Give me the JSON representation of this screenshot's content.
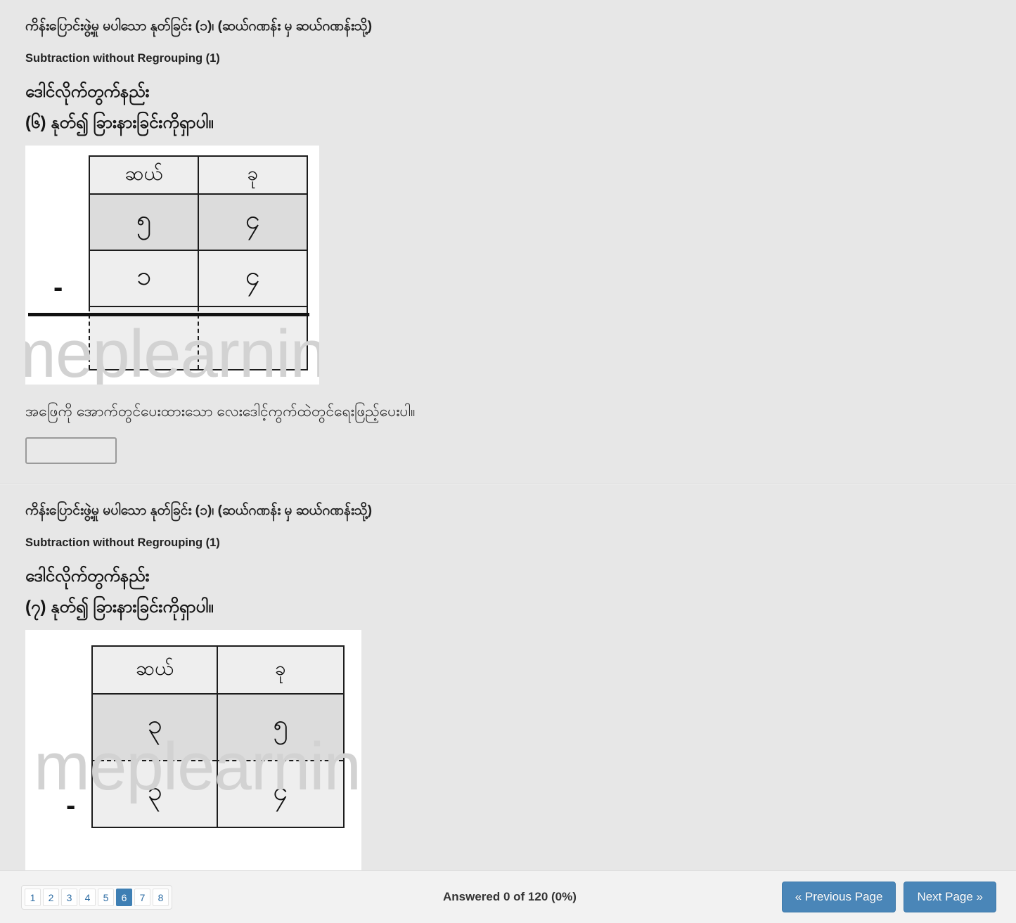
{
  "questions": [
    {
      "title_my": "ကိန်းပြောင်းဖွဲ့မှု မပါသော နုတ်ခြင်း (၁)၊ (ဆယ်ဂဏန်း မှ ဆယ်ဂဏန်းသို့)",
      "title_en": "Subtraction without Regrouping (1)",
      "method_my": "ဒေါင်လိုက်တွက်နည်း",
      "prompt_my": "(၆) နုတ်၍ ခြားနားခြင်းကိုရှာပါ။",
      "table": {
        "headers": [
          "ဆယ်",
          "ခု"
        ],
        "minuend": [
          "၅",
          "၄"
        ],
        "subtrahend": [
          "၁",
          "၄"
        ],
        "answer_row": [
          "",
          ""
        ],
        "operator": "-"
      },
      "watermark": "meplearning",
      "answer_instruction_my": "အဖြေကို အောက်တွင်ပေးထားသော လေးဒေါင့်ကွက်ထဲတွင်ရေးဖြည့်ပေးပါ။",
      "answer_value": "",
      "answer_placeholder": ""
    },
    {
      "title_my": "ကိန်းပြောင်းဖွဲ့မှု မပါသော နုတ်ခြင်း (၁)၊ (ဆယ်ဂဏန်း မှ ဆယ်ဂဏန်းသို့)",
      "title_en": "Subtraction without Regrouping (1)",
      "method_my": "ဒေါင်လိုက်တွက်နည်း",
      "prompt_my": "(၇) နုတ်၍ ခြားနားခြင်းကိုရှာပါ။",
      "table": {
        "headers": [
          "ဆယ်",
          "ခု"
        ],
        "minuend": [
          "၃",
          "၅"
        ],
        "subtrahend": [
          "၃",
          "၄"
        ],
        "answer_row": [
          "",
          ""
        ],
        "operator": "-"
      },
      "watermark": "meplearning"
    }
  ],
  "toolbar": {
    "pages": [
      "1",
      "2",
      "3",
      "4",
      "5",
      "6",
      "7",
      "8"
    ],
    "active_page": "6",
    "status": "Answered 0 of 120 (0%)",
    "previous_label": "« Previous Page",
    "next_label": "Next Page »"
  },
  "colors": {
    "page_background": "#e7e7e7",
    "accent_blue": "#3e7fb4",
    "button_blue": "#4a86b8",
    "link_blue": "#2e6da4",
    "cell_light": "#eeeeee",
    "cell_dark": "#dcdcdc",
    "watermark_gray": "#d2d2d2"
  }
}
